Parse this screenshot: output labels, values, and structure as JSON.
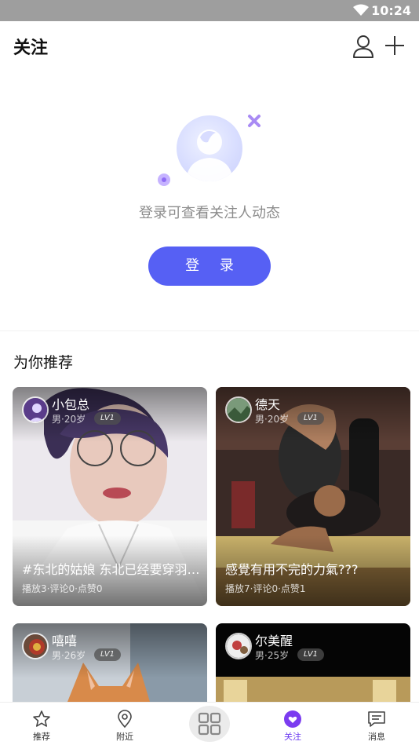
{
  "status_bar": {
    "time": "10:24"
  },
  "header": {
    "title": "关注"
  },
  "empty_state": {
    "message": "登录可查看关注人动态",
    "login_button": "登 录"
  },
  "recommend": {
    "title": "为你推荐",
    "cards": [
      {
        "name": "小包总",
        "meta": "男·20岁",
        "level": "LV1",
        "caption": "#东北的姑娘  东北已经要穿羽…",
        "stats": "播放3·评论0·点赞0"
      },
      {
        "name": "德天",
        "meta": "男·20岁",
        "level": "LV1",
        "caption": "感覺有用不完的力氣???",
        "stats": "播放7·评论0·点赞1"
      },
      {
        "name": "嘻嘻",
        "meta": "男·26岁",
        "level": "LV1"
      },
      {
        "name": "尔美醒",
        "meta": "男·25岁",
        "level": "LV1"
      }
    ]
  },
  "tabbar": {
    "tabs": [
      {
        "label": "推荐",
        "icon": "star-icon"
      },
      {
        "label": "附近",
        "icon": "location-pin-icon"
      },
      {
        "label": "",
        "icon": "grid-icon"
      },
      {
        "label": "关注",
        "icon": "heart-icon",
        "active": true
      },
      {
        "label": "消息",
        "icon": "message-icon"
      }
    ]
  },
  "colors": {
    "accent": "#5660f4",
    "active_tab": "#6a38f0",
    "status_bar": "#9e9e9e"
  }
}
